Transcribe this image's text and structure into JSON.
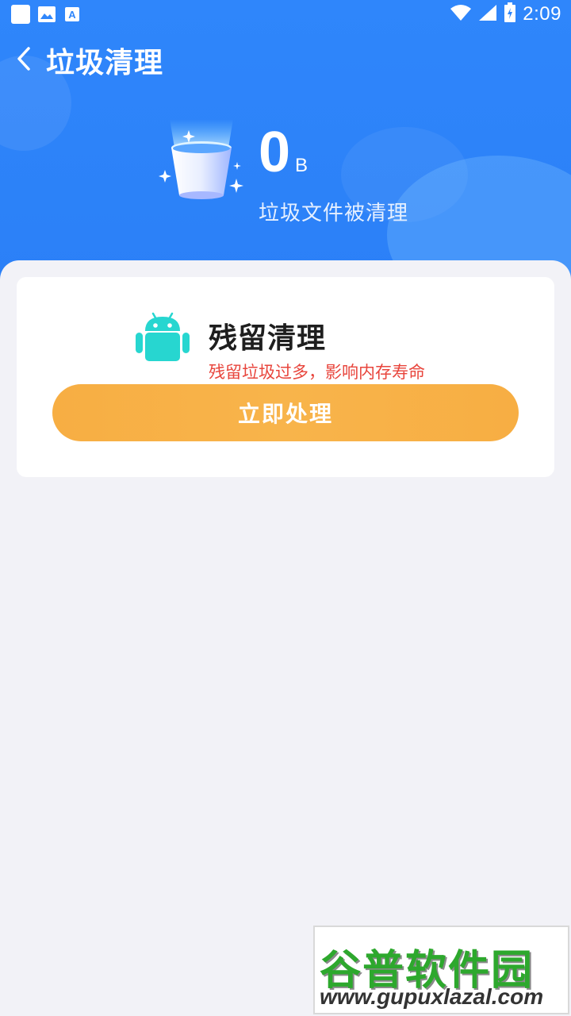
{
  "status_bar": {
    "time": "2:09",
    "left_icons": [
      "square-icon",
      "image-icon",
      "font-icon"
    ],
    "right_icons": [
      "wifi-icon",
      "signal-icon",
      "battery-icon"
    ]
  },
  "topbar": {
    "back_icon": "chevron-left-icon",
    "title": "垃圾清理"
  },
  "summary": {
    "size_value": "0",
    "size_unit": "B",
    "subtitle": "垃圾文件被清理",
    "icon": "trash-bucket-icon"
  },
  "card": {
    "icon": "android-icon",
    "title": "残留清理",
    "description": "残留垃圾过多，影响内存寿命",
    "button_label": "立即处理"
  },
  "watermark": {
    "title": "谷普软件园",
    "url": "www.gupuxlazal.com"
  },
  "colors": {
    "header_blue": "#2f86fb",
    "button_orange": "#f8b44b",
    "warning_red": "#e8453c",
    "android_teal": "#27d6d0"
  }
}
